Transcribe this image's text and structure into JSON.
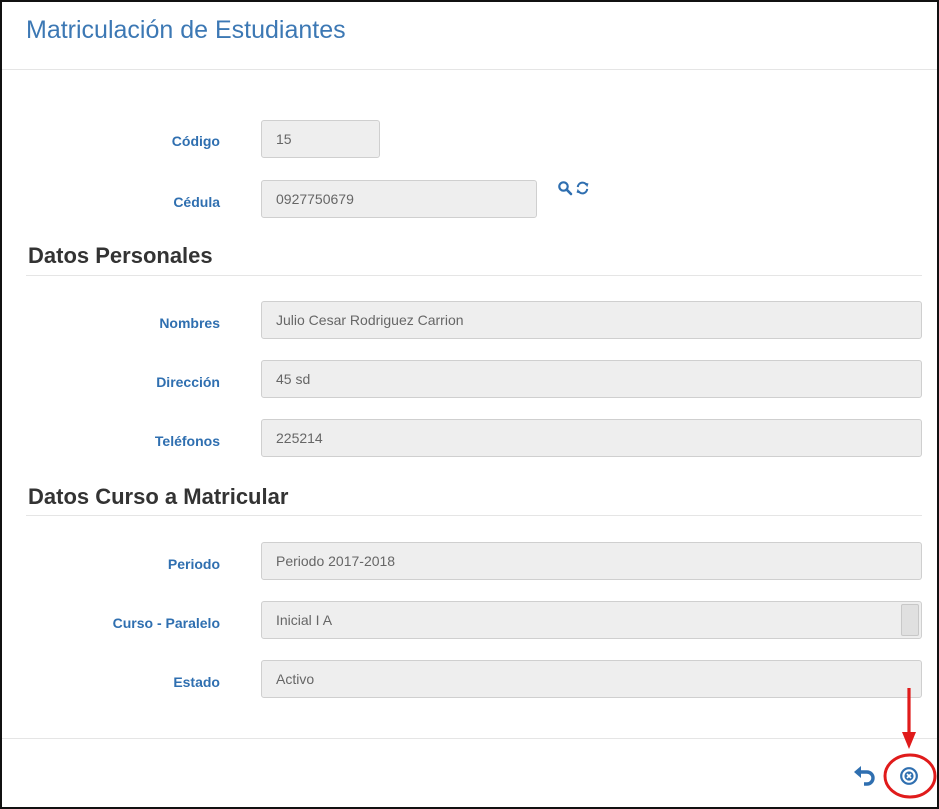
{
  "title": "Matriculación de Estudiantes",
  "fields": {
    "codigo": {
      "label": "Código",
      "value": "15"
    },
    "cedula": {
      "label": "Cédula",
      "value": "0927750679"
    }
  },
  "personal": {
    "section_title": "Datos Personales",
    "nombres": {
      "label": "Nombres",
      "value": "Julio Cesar Rodriguez Carrion"
    },
    "direccion": {
      "label": "Dirección",
      "value": "45 sd"
    },
    "telefonos": {
      "label": "Teléfonos",
      "value": "225214"
    }
  },
  "curso": {
    "section_title": "Datos Curso a Matricular",
    "periodo": {
      "label": "Periodo",
      "value": "Periodo 2017-2018"
    },
    "curso_paralelo": {
      "label": "Curso - Paralelo",
      "value": "Inicial I A"
    },
    "estado": {
      "label": "Estado",
      "value": "Activo"
    }
  },
  "icons": {
    "search": "search-icon",
    "refresh": "refresh-icon",
    "undo": "undo-icon",
    "close": "close-circle-icon"
  },
  "colors": {
    "accent": "#3c78b4",
    "label": "#2f6fb0",
    "annotation": "#e01b1b"
  }
}
